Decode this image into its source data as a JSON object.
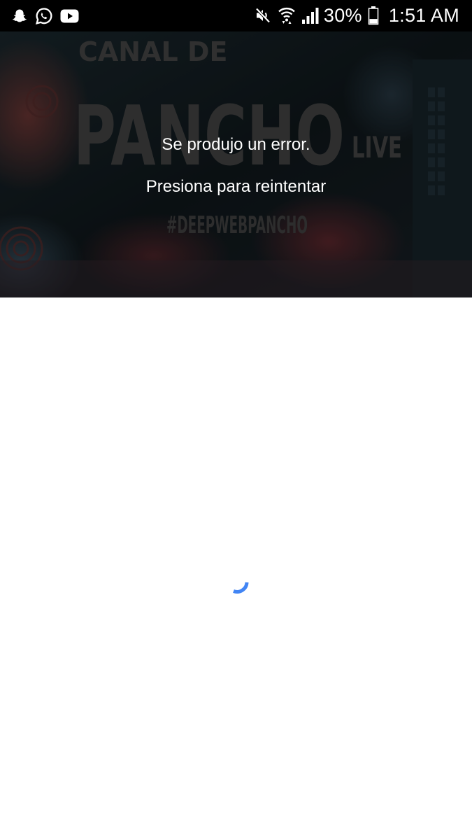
{
  "status_bar": {
    "notification_icons": [
      "snapchat-icon",
      "whatsapp-icon",
      "youtube-icon"
    ],
    "system_icons": [
      "mute-icon",
      "wifi-icon",
      "signal-icon"
    ],
    "battery_percent": "30%",
    "battery_level": 0.3,
    "time": "1:51 AM"
  },
  "video": {
    "thumbnail": {
      "line1": "CANAL DE",
      "line2": "PANCHO",
      "badge": "LIVE",
      "hashtag": "#DEEPWEBPANCHO"
    },
    "error_message": "Se produjo un error.",
    "retry_label": "Presiona para reintentar"
  },
  "content": {
    "loading": true
  },
  "colors": {
    "status_bar_bg": "#000000",
    "spinner": "#4285F4",
    "overlay_text": "#FFFFFF",
    "page_bg": "#FFFFFF"
  }
}
